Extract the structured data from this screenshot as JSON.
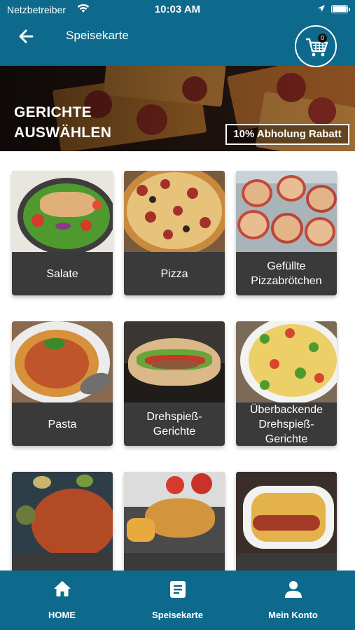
{
  "status_bar": {
    "carrier": "Netzbetreiber",
    "time": "10:03 AM"
  },
  "app_bar": {
    "title": "Speisekarte",
    "cart_count": "0"
  },
  "hero": {
    "title": "GERICHTE\nAUSWÄHLEN",
    "badge": "10% Abholung Rabatt"
  },
  "categories": [
    {
      "label": "Salate"
    },
    {
      "label": "Pizza"
    },
    {
      "label": "Gefüllte Pizzabrötchen"
    },
    {
      "label": "Pasta"
    },
    {
      "label": "Drehspieß-Gerichte"
    },
    {
      "label": "Überbackende Drehspieß-Gerichte"
    },
    {
      "label": ""
    },
    {
      "label": ""
    },
    {
      "label": ""
    }
  ],
  "bottom_nav": {
    "items": [
      {
        "label": "HOME",
        "icon": "home-icon"
      },
      {
        "label": "Speisekarte",
        "icon": "menu-book-icon"
      },
      {
        "label": "Mein Konto",
        "icon": "user-icon"
      }
    ]
  },
  "colors": {
    "primary": "#0e6a8c",
    "card_label_bg": "#3a3a3a"
  }
}
